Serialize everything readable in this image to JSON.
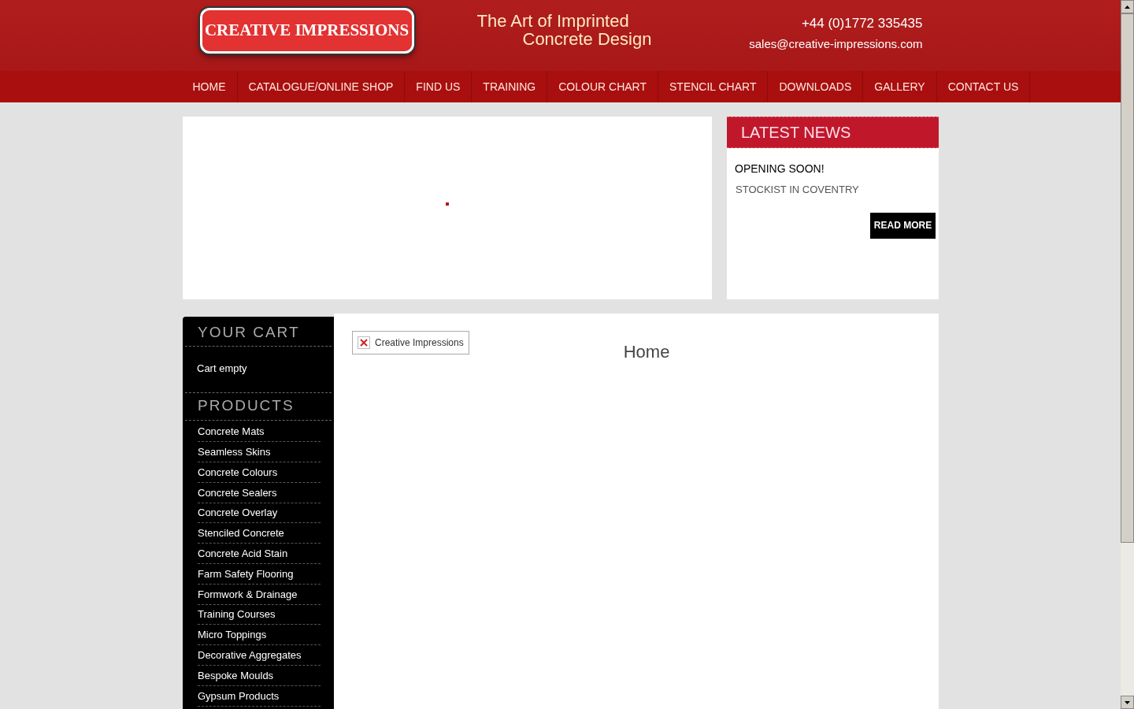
{
  "header": {
    "logo": "CREATIVE IMPRESSIONS",
    "tagline_1": "The Art of Imprinted",
    "tagline_2": "Concrete Design",
    "phone": "+44 (0)1772 335435",
    "email": "sales@creative-impressions.com"
  },
  "nav": [
    {
      "label": "HOME"
    },
    {
      "label": "CATALOGUE/ONLINE SHOP"
    },
    {
      "label": "FIND US"
    },
    {
      "label": "TRAINING"
    },
    {
      "label": "COLOUR CHART"
    },
    {
      "label": "STENCIL CHART"
    },
    {
      "label": "DOWNLOADS"
    },
    {
      "label": "GALLERY"
    },
    {
      "label": "CONTACT US"
    }
  ],
  "news": {
    "title": "LATEST NEWS",
    "headline": "OPENING SOON!",
    "summary": "STOCKIST IN COVENTRY",
    "button": "READ MORE"
  },
  "cart": {
    "title": "YOUR CART",
    "status": "Cart empty"
  },
  "products": {
    "title": "PRODUCTS",
    "items": [
      "Concrete Mats",
      "Seamless Skins",
      "Concrete Colours",
      "Concrete Sealers",
      "Concrete Overlay",
      "Stenciled Concrete",
      "Concrete Acid Stain",
      "Farm Safety Flooring",
      "Formwork & Drainage",
      "Training Courses",
      "Micro Toppings",
      "Decorative Aggregates",
      "Bespoke Moulds",
      "Gypsum Products"
    ]
  },
  "main": {
    "broken_image_alt": "Creative Impressions",
    "heading": "Home"
  }
}
